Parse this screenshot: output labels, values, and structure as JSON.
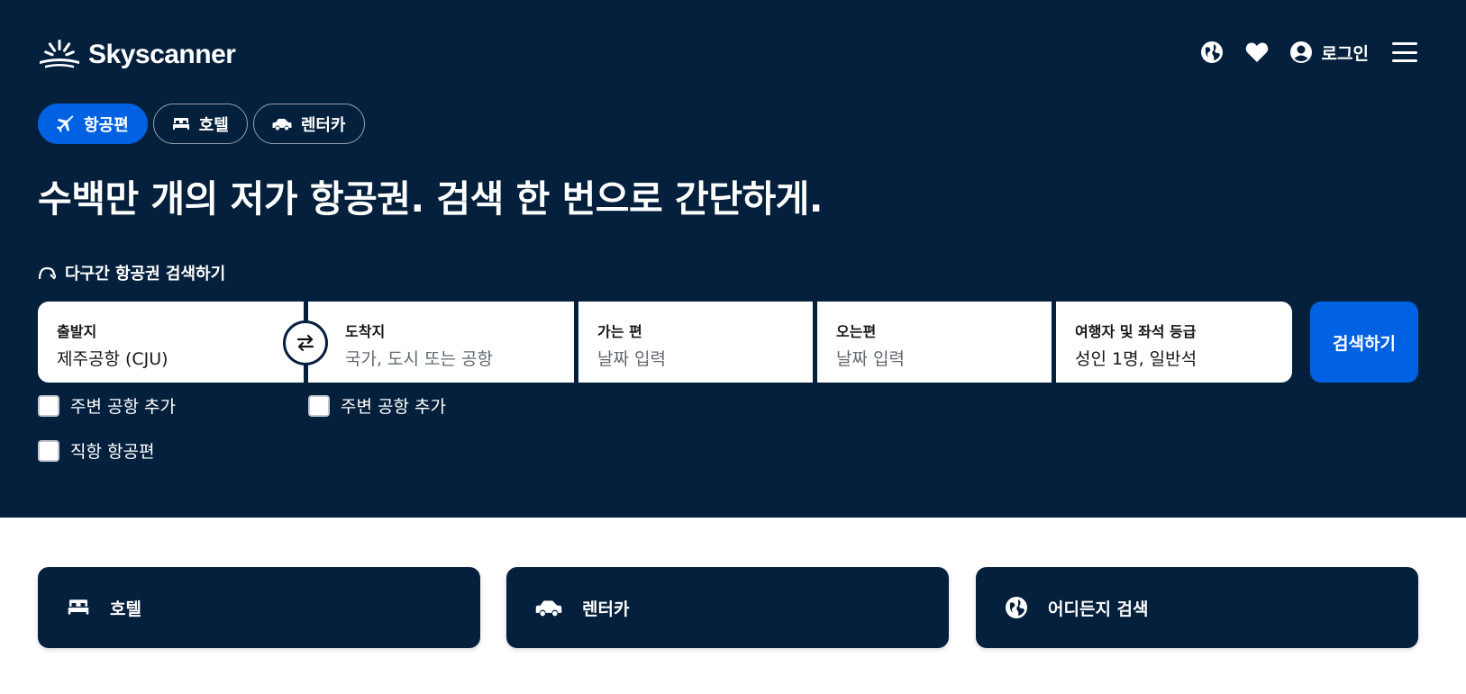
{
  "brand": {
    "name": "Skyscanner",
    "accent": "#0062e3",
    "navy": "#05203c"
  },
  "header": {
    "login_label": "로그인",
    "icons": [
      "globe-icon",
      "heart-icon",
      "user-icon",
      "menu-icon"
    ]
  },
  "tabs": [
    {
      "label": "항공편",
      "icon": "plane-icon",
      "active": true
    },
    {
      "label": "호텔",
      "icon": "bed-icon",
      "active": false
    },
    {
      "label": "렌터카",
      "icon": "car-icon",
      "active": false
    }
  ],
  "headline": "수백만 개의 저가 항공권. 검색 한 번으로 간단하게.",
  "multi_city_label": "다구간 항공권 검색하기",
  "search": {
    "origin": {
      "label": "출발지",
      "value": "제주공항 (CJU)"
    },
    "destination": {
      "label": "도착지",
      "placeholder": "국가, 도시 또는 공항"
    },
    "depart": {
      "label": "가는 편",
      "placeholder": "날짜 입력"
    },
    "return": {
      "label": "오는편",
      "placeholder": "날짜 입력"
    },
    "travellers": {
      "label": "여행자 및 좌석 등급",
      "value": "성인 1명, 일반석"
    },
    "button_label": "검색하기"
  },
  "checkboxes": {
    "origin_nearby": {
      "label": "주변 공항 추가",
      "checked": false
    },
    "dest_nearby": {
      "label": "주변 공항 추가",
      "checked": false
    },
    "direct": {
      "label": "직항 항공편",
      "checked": false
    }
  },
  "cards": [
    {
      "label": "호텔",
      "icon": "bed-icon"
    },
    {
      "label": "렌터카",
      "icon": "car-icon"
    },
    {
      "label": "어디든지 검색",
      "icon": "globe-icon"
    }
  ]
}
